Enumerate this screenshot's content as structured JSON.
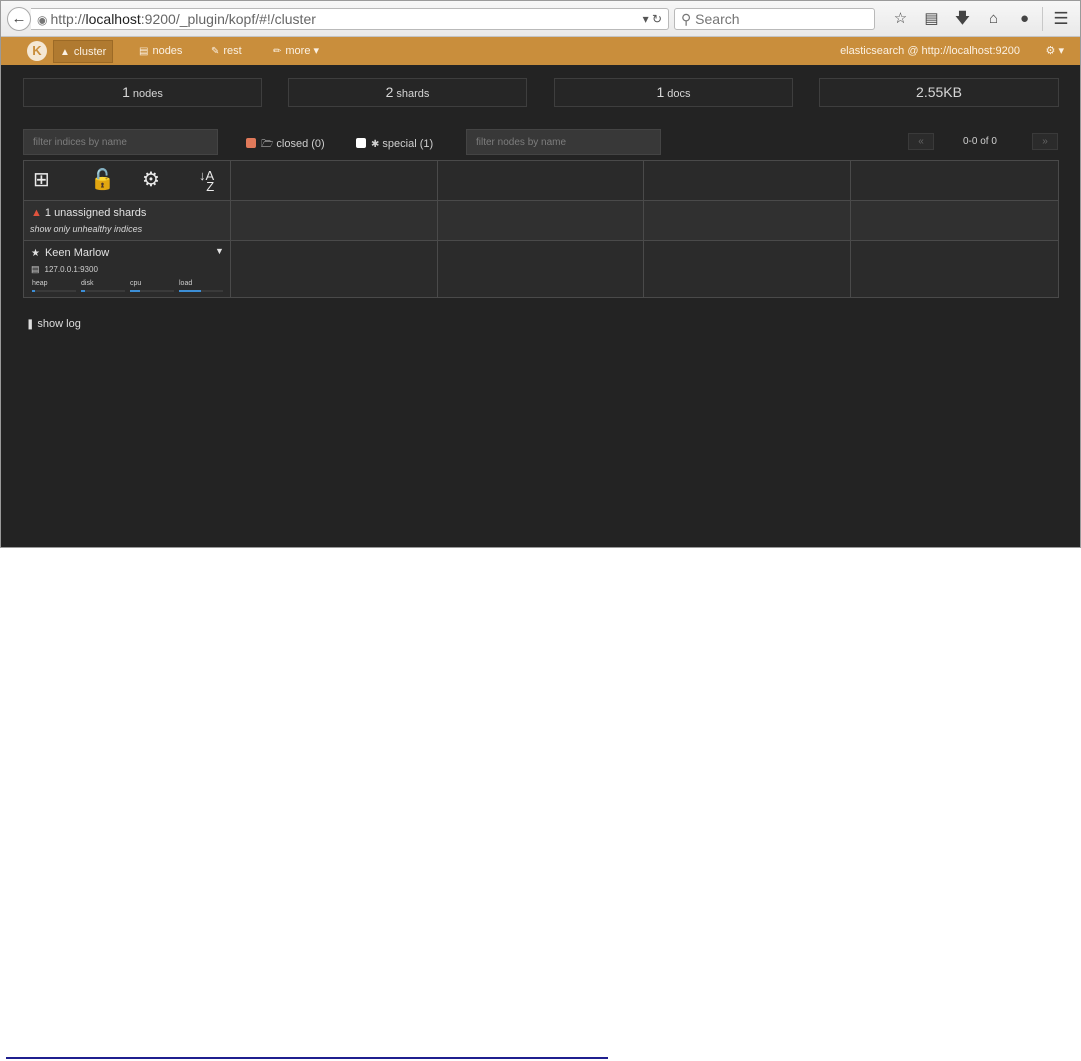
{
  "browser": {
    "url_scheme": "http://",
    "url_host": "localhost",
    "url_rest": ":9200/_plugin/kopf/#!/cluster",
    "search_placeholder": "Search",
    "icons": [
      "star-icon",
      "reading-list-icon",
      "download-icon",
      "home-icon",
      "chat-icon",
      "menu-icon"
    ]
  },
  "navbar": {
    "logo": "K",
    "items": [
      {
        "label": "cluster",
        "icon": "sitemap-icon"
      },
      {
        "label": "nodes",
        "icon": "server-icon"
      },
      {
        "label": "rest",
        "icon": "edit-icon"
      },
      {
        "label": "more",
        "icon": "wrench-icon"
      }
    ],
    "connection": "elasticsearch @ http://localhost:9200"
  },
  "stats": {
    "nodes": {
      "value": "1",
      "label": "nodes"
    },
    "shards": {
      "value": "2",
      "label": "shards"
    },
    "docs": {
      "value": "1",
      "label": "docs"
    },
    "size": {
      "value": "2.55KB",
      "label": ""
    }
  },
  "filters": {
    "indices_placeholder": "filter indices by name",
    "closed_label": "closed (0)",
    "closed_checked": true,
    "special_label": "special (1)",
    "special_checked": false,
    "nodes_placeholder": "filter nodes by name",
    "pager_prev": "«",
    "pager_text": "0-0 of 0",
    "pager_next": "»"
  },
  "grid": {
    "commands": [
      "create-index-icon",
      "unlock-icon",
      "settings-icon",
      "sort-alpha-icon"
    ],
    "unassigned": "1 unassigned shards",
    "healthy_link": "show only unhealthy indices",
    "node": {
      "name": "Keen Marlow",
      "address": "127.0.0.1:9300",
      "metrics": [
        {
          "label": "heap",
          "level": 0.06
        },
        {
          "label": "disk",
          "level": 0.08
        },
        {
          "label": "cpu",
          "level": 0.22
        },
        {
          "label": "load",
          "level": 0.5
        }
      ]
    }
  },
  "show_log": "show log",
  "colors": {
    "navbar": "#c98e3c",
    "background": "#232323",
    "warning": "#e0533d",
    "metric_fill": "#3c8ed6",
    "closed_checkbox": "#e0795a"
  }
}
